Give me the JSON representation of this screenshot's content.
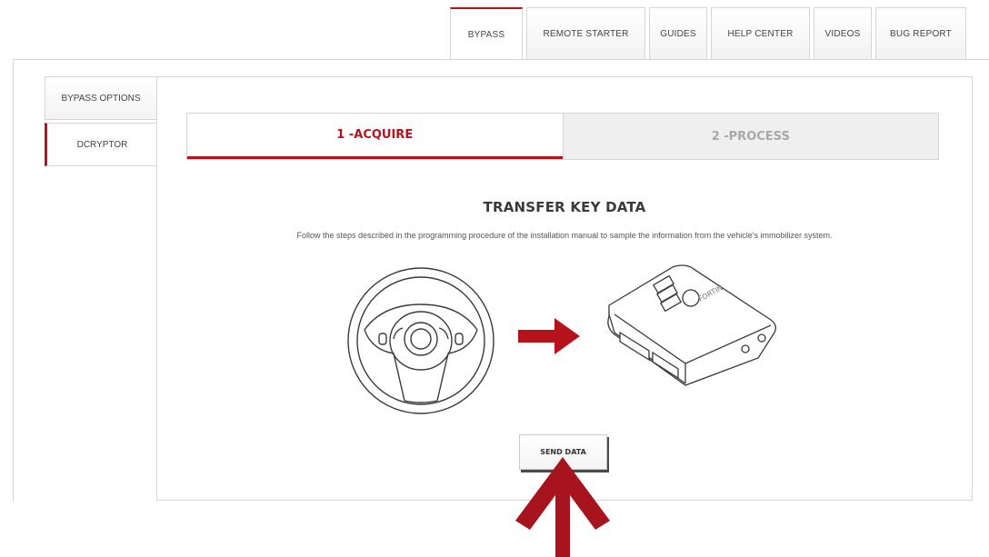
{
  "top_tabs": [
    {
      "label": "BYPASS",
      "active": true
    },
    {
      "label": "REMOTE STARTER",
      "active": false
    },
    {
      "label": "GUIDES",
      "active": false
    },
    {
      "label": "HELP CENTER",
      "active": false
    },
    {
      "label": "VIDEOS",
      "active": false
    },
    {
      "label": "BUG REPORT",
      "active": false
    }
  ],
  "side_tabs": [
    {
      "label": "BYPASS OPTIONS",
      "active": false
    },
    {
      "label": "DCRYPTOR",
      "active": true
    }
  ],
  "steps": [
    {
      "label": "1 -ACQUIRE",
      "active": true
    },
    {
      "label": "2 -PROCESS",
      "active": false
    }
  ],
  "main": {
    "title": "TRANSFER KEY DATA",
    "description": "Follow the steps described in the programming procedure of the installation manual to sample the information from the vehicle's immobilizer system.",
    "send_button": "SEND DATA"
  },
  "icons": {
    "wheel": "steering-wheel-icon",
    "arrow": "arrow-right-icon",
    "module": "bypass-module-icon",
    "pointer": "arrow-up-icon"
  },
  "colors": {
    "accent": "#b5121b",
    "border": "#d6d6d6",
    "inactive_bg": "#efefef",
    "inactive_text": "#a8a8a8"
  }
}
